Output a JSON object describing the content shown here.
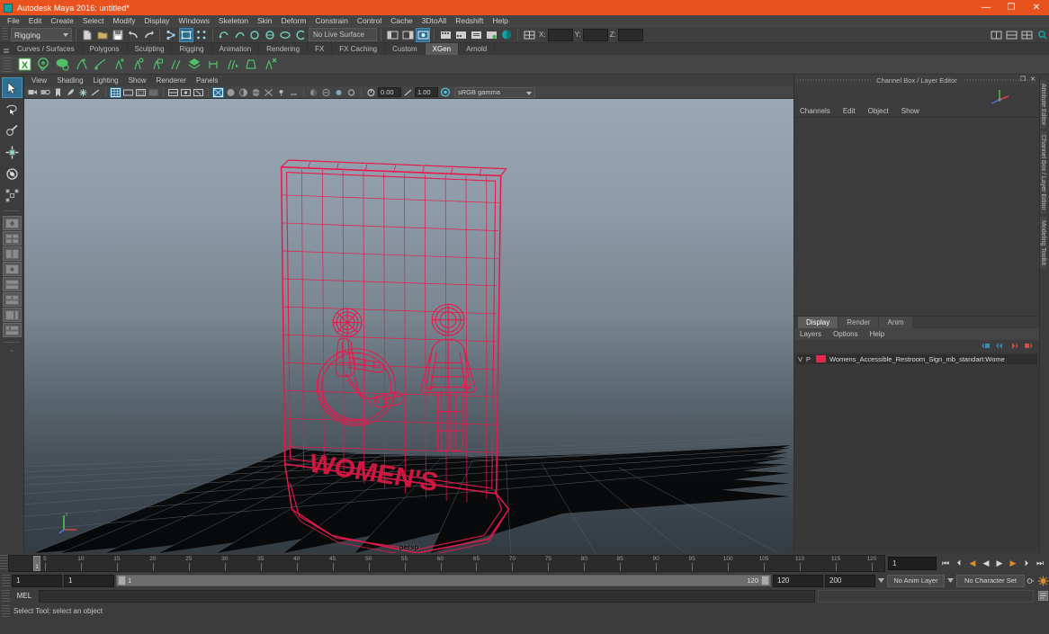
{
  "window": {
    "title": "Autodesk Maya 2016: untitled*",
    "minimize": "—",
    "maximize": "❐",
    "close": "✕"
  },
  "menubar": {
    "items": [
      {
        "label": "File"
      },
      {
        "label": "Edit"
      },
      {
        "label": "Create"
      },
      {
        "label": "Select"
      },
      {
        "label": "Modify"
      },
      {
        "label": "Display"
      },
      {
        "label": "Windows"
      },
      {
        "label": "Skeleton"
      },
      {
        "label": "Skin"
      },
      {
        "label": "Deform"
      },
      {
        "label": "Constrain"
      },
      {
        "label": "Control"
      },
      {
        "label": "Cache"
      },
      {
        "label": "3DtoAll"
      },
      {
        "label": "Redshift"
      },
      {
        "label": "Help"
      }
    ]
  },
  "statusbar": {
    "mode": "Rigging",
    "live_surface": "No Live Surface",
    "coord_labels": [
      "X:",
      "Y:",
      "Z:"
    ],
    "coord_values": [
      "",
      "",
      ""
    ]
  },
  "shelf": {
    "tabs": [
      {
        "label": "Curves / Surfaces",
        "active": false
      },
      {
        "label": "Polygons",
        "active": false
      },
      {
        "label": "Sculpting",
        "active": false
      },
      {
        "label": "Rigging",
        "active": false
      },
      {
        "label": "Animation",
        "active": false
      },
      {
        "label": "Rendering",
        "active": false
      },
      {
        "label": "FX",
        "active": false
      },
      {
        "label": "FX Caching",
        "active": false
      },
      {
        "label": "Custom",
        "active": false
      },
      {
        "label": "XGen",
        "active": true
      },
      {
        "label": "Arnold",
        "active": false
      }
    ],
    "icons": [
      {
        "name": "xgen-logo-icon"
      },
      {
        "name": "xgen-preview-icon"
      },
      {
        "name": "xgen-description-icon"
      },
      {
        "name": "xgen-add-collection-icon"
      },
      {
        "name": "xgen-guide-icon"
      },
      {
        "name": "xgen-add-guide-icon"
      },
      {
        "name": "xgen-select-guide-icon"
      },
      {
        "name": "xgen-lock-guide-icon"
      },
      {
        "name": "xgen-clear-guide-icon"
      },
      {
        "name": "xgen-groom-icon"
      },
      {
        "name": "xgen-density-icon"
      },
      {
        "name": "xgen-region-icon"
      },
      {
        "name": "xgen-mask-icon"
      },
      {
        "name": "xgen-delete-icon"
      }
    ]
  },
  "toolbox": {
    "tools": [
      {
        "name": "select-tool",
        "active": true
      },
      {
        "name": "lasso-select-tool",
        "active": false
      },
      {
        "name": "paint-select-tool",
        "active": false
      },
      {
        "name": "move-tool",
        "active": false
      },
      {
        "name": "rotate-tool",
        "active": false
      },
      {
        "name": "scale-tool",
        "active": false
      }
    ],
    "layouts": 8
  },
  "viewport": {
    "panel_menus": [
      "View",
      "Shading",
      "Lighting",
      "Show",
      "Renderer",
      "Panels"
    ],
    "camera_label": "persp",
    "exposure": "0.00",
    "gamma": "1.00",
    "color_space": "sRGB gamma",
    "model": {
      "sign_text": "WOMEN'S",
      "wireframe_color": "#e81f4e"
    }
  },
  "channelbox": {
    "title": "Channel Box / Layer Editor",
    "menus": [
      "Channels",
      "Edit",
      "Object",
      "Show"
    ],
    "undock": "❐",
    "close": "✕"
  },
  "layereditor": {
    "tabs": [
      {
        "label": "Display",
        "active": true
      },
      {
        "label": "Render",
        "active": false
      },
      {
        "label": "Anim",
        "active": false
      }
    ],
    "menus": [
      "Layers",
      "Options",
      "Help"
    ],
    "layers": [
      {
        "visibility": "V",
        "playback": "P",
        "color": "#e8244f",
        "name": "Womens_Accessible_Restroom_Sign_mb_standart:Wome"
      }
    ]
  },
  "sidetabs": [
    {
      "label": "Attribute Editor"
    },
    {
      "label": "Channel Box / Layer Editor"
    },
    {
      "label": "Modeling Toolkit"
    }
  ],
  "timeslider": {
    "start": 1,
    "end": 120,
    "current": "1",
    "tick_labels": [
      "5",
      "10",
      "15",
      "20",
      "25",
      "30",
      "35",
      "40",
      "45",
      "50",
      "55",
      "60",
      "65",
      "70",
      "75",
      "80",
      "85",
      "90",
      "95",
      "100",
      "105",
      "110",
      "115",
      "120"
    ],
    "transport": [
      {
        "name": "go-to-start-button",
        "glyph": "⏮"
      },
      {
        "name": "step-back-frame-button",
        "glyph": "⏴"
      },
      {
        "name": "step-back-key-button",
        "glyph": "◀"
      },
      {
        "name": "play-backwards-button",
        "glyph": "◀"
      },
      {
        "name": "play-forwards-button",
        "glyph": "▶"
      },
      {
        "name": "step-forward-key-button",
        "glyph": "▶"
      },
      {
        "name": "step-forward-frame-button",
        "glyph": "⏵"
      },
      {
        "name": "go-to-end-button",
        "glyph": "⏭"
      }
    ]
  },
  "rangeslider": {
    "anim_start": "1",
    "range_start": "1",
    "bar_start": "1",
    "bar_end": "120",
    "range_end": "120",
    "anim_end": "200",
    "anim_layer": "No Anim Layer",
    "character_set": "No Character Set"
  },
  "commandline": {
    "language": "MEL",
    "input_value": "",
    "output_value": ""
  },
  "helpline": {
    "text": "Select Tool: select an object"
  }
}
